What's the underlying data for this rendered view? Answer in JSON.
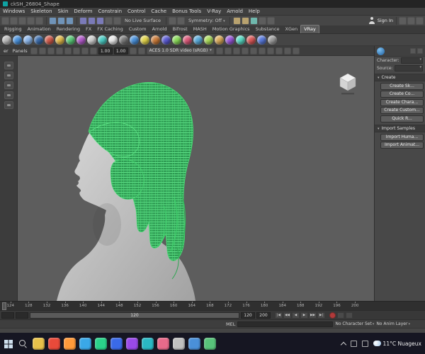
{
  "window": {
    "title": "ckSH_26804_Shape"
  },
  "menubar": {
    "items": [
      "Windows",
      "Skeleton",
      "Skin",
      "Deform",
      "Constrain",
      "Control",
      "Cache",
      "Bonus Tools",
      "V-Ray",
      "Arnold",
      "Help"
    ]
  },
  "statusline": {
    "no_live_surface": "No Live Surface",
    "symmetry": "Symmetry: Off",
    "sign_in": "Sign In"
  },
  "shelf": {
    "tabs": [
      "Rigging",
      "Animation",
      "Rendering",
      "FX",
      "FX Caching",
      "Custom",
      "Arnold",
      "Bifrost",
      "MASH",
      "Motion Graphics",
      "Substance",
      "XGen",
      "VRay"
    ],
    "active_index": 12,
    "icon_colors": [
      "#b8b8b8",
      "#4a90d9",
      "#8ab4e8",
      "#3a6aa8",
      "#d05a4a",
      "#e0b84a",
      "#5ac878",
      "#b05ac8",
      "#cccccc",
      "#4ac8c0",
      "#e8e8e8",
      "#7a7a7a",
      "#4a90d9",
      "#e0d24a",
      "#c87a3a",
      "#5a5ad0",
      "#88d858",
      "#d85878",
      "#58a8d8",
      "#a8d858",
      "#d8a858",
      "#9858d8",
      "#58d8c2",
      "#d85858",
      "#5878d8",
      "#9a9a9a"
    ]
  },
  "panelbar": {
    "menu_partial": "er",
    "panels_menu": "Panels",
    "exposure": "1.00",
    "gamma": "1.00",
    "colorspace": "ACES 1.0 SDR video (sRGB)"
  },
  "right_panel": {
    "character_label": "Character:",
    "source_label": "Source:",
    "create_section": "Create",
    "create_buttons": [
      "Create Sk...",
      "Create Co...",
      "Create Chara...",
      "Create Custom...",
      "Quick R..."
    ],
    "import_section": "Import Samples",
    "import_buttons": [
      "Import Huma...",
      "Import Animat..."
    ]
  },
  "timeline": {
    "labels": [
      "124",
      "128",
      "132",
      "136",
      "140",
      "144",
      "148",
      "152",
      "156",
      "160",
      "164",
      "168",
      "172",
      "176",
      "180",
      "184",
      "188",
      "192",
      "196",
      "200"
    ]
  },
  "range_slider": {
    "bar_label": "120",
    "start": "120",
    "end": "200"
  },
  "transport": [
    "|◀",
    "◀◀",
    "◀",
    "▶",
    "▶▶",
    "▶|"
  ],
  "command_line": {
    "mel_label": "MEL",
    "character_set": "No Character Set",
    "anim_layer": "No Anim Layer"
  },
  "taskbar": {
    "weather": "11°C Nuageux",
    "app_colors": [
      "#e8c14a",
      "#e84a3a",
      "#ff9a3a",
      "#3aa8e8",
      "#2ad18a",
      "#3a6ae8",
      "#9a4ae8",
      "#2ab8c4",
      "#e86a8a",
      "#c0c0c0",
      "#4a90d9",
      "#58c27a"
    ]
  },
  "colors": {
    "wire_green": "#52f07f",
    "viewport_bg": "#5d5d5d",
    "model_gray": "#c8c8c8"
  }
}
